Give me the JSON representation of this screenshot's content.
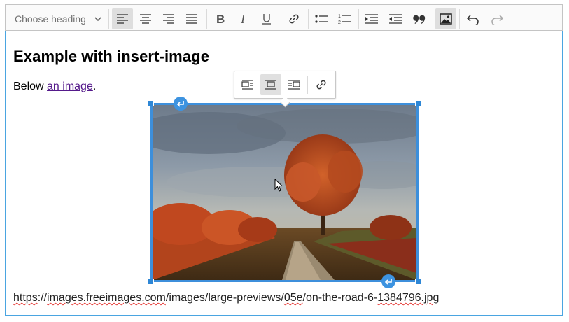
{
  "toolbar": {
    "heading_placeholder": "Choose heading",
    "buttons": [
      {
        "name": "align-left-button",
        "active": true
      },
      {
        "name": "align-center-button",
        "active": false
      },
      {
        "name": "align-right-button",
        "active": false
      },
      {
        "name": "align-justify-button",
        "active": false
      },
      {
        "name": "bold-button",
        "active": false
      },
      {
        "name": "italic-button",
        "active": false
      },
      {
        "name": "underline-button",
        "active": false
      },
      {
        "name": "link-button",
        "active": false
      },
      {
        "name": "bulleted-list-button",
        "active": false
      },
      {
        "name": "numbered-list-button",
        "active": false
      },
      {
        "name": "outdent-button",
        "active": false
      },
      {
        "name": "indent-button",
        "active": false
      },
      {
        "name": "blockquote-button",
        "active": false
      },
      {
        "name": "insert-image-button",
        "active": true
      },
      {
        "name": "undo-button",
        "active": false
      },
      {
        "name": "redo-button",
        "active": false
      }
    ]
  },
  "document": {
    "heading": "Example with insert-image",
    "para_prefix": "Below ",
    "para_link": "an image",
    "para_suffix": ".",
    "url_parts": [
      "https",
      "://",
      "images.freeimages.com",
      "/images/large-previews/",
      "05e",
      "/on-the-road-6-",
      "1384796.jpg"
    ]
  },
  "image_toolbar": {
    "buttons": [
      {
        "name": "image-wrap-left-button",
        "active": false
      },
      {
        "name": "image-inline-center-button",
        "active": true
      },
      {
        "name": "image-wrap-right-button",
        "active": false
      },
      {
        "name": "image-link-button",
        "active": false
      }
    ]
  },
  "colors": {
    "focus_border": "#4aa5e1",
    "selection_blue": "#3d8fdb",
    "toolbar_bg": "#fafafa",
    "active_button": "#dedede",
    "link": "#551a8b",
    "spellcheck": "#e53935"
  }
}
